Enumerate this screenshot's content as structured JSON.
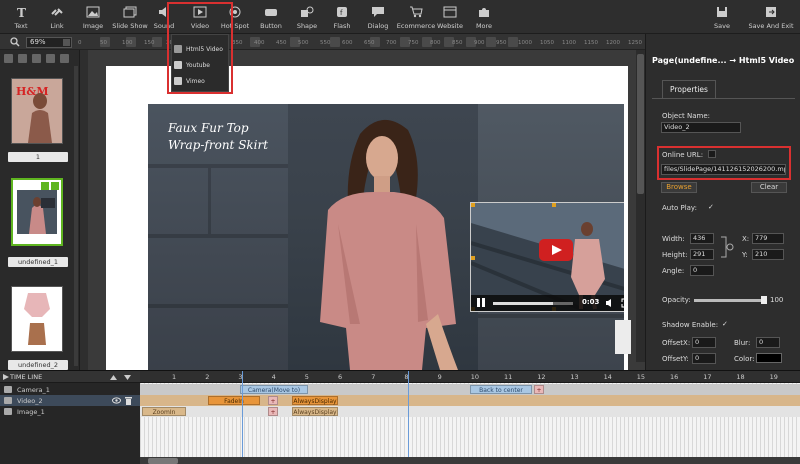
{
  "toolbar": {
    "tools": [
      {
        "label": "Text",
        "icon": "text-icon"
      },
      {
        "label": "Link",
        "icon": "link-icon"
      },
      {
        "label": "Image",
        "icon": "image-icon"
      },
      {
        "label": "Slide Show",
        "icon": "slideshow-icon"
      },
      {
        "label": "Sound",
        "icon": "sound-icon"
      },
      {
        "label": "Video",
        "icon": "video-icon"
      },
      {
        "label": "Hot Spot",
        "icon": "hotspot-icon"
      },
      {
        "label": "Button",
        "icon": "button-icon"
      },
      {
        "label": "Shape",
        "icon": "shape-icon"
      },
      {
        "label": "Flash",
        "icon": "flash-icon"
      },
      {
        "label": "Dialog",
        "icon": "dialog-icon"
      },
      {
        "label": "Ecommerce",
        "icon": "cart-icon"
      },
      {
        "label": "Website",
        "icon": "website-icon"
      },
      {
        "label": "More",
        "icon": "puzzle-icon"
      }
    ],
    "save_label": "Save",
    "save_exit_label": "Save And Exit"
  },
  "video_menu": {
    "items": [
      {
        "label": "Html5 Video",
        "icon": "html5-icon"
      },
      {
        "label": "Youtube",
        "icon": "youtube-icon"
      },
      {
        "label": "Vimeo",
        "icon": "vimeo-icon"
      }
    ]
  },
  "zoom": {
    "value": "69%"
  },
  "ruler_ticks": [
    "0",
    "50",
    "100",
    "150",
    "200",
    "250",
    "300",
    "350",
    "400",
    "450",
    "500",
    "550",
    "600",
    "650",
    "700",
    "750",
    "800",
    "850",
    "900",
    "950",
    "1000",
    "1050",
    "1100",
    "1150",
    "1200",
    "1250"
  ],
  "slides": [
    {
      "label": "1"
    },
    {
      "label": "undefined_1"
    },
    {
      "label": "undefined_2"
    }
  ],
  "canvas": {
    "caption_line1": "Faux Fur Top",
    "caption_line2": "Wrap-front Skirt",
    "video_time": "0:03",
    "video_progress": 0.75
  },
  "properties": {
    "title": "Page(undefine... → Html5 Video",
    "tab": "Properties",
    "object_name_label": "Object Name:",
    "object_name": "Video_2",
    "online_url_label": "Online URL:",
    "file_path": "files/SlidePage/1411261520262​00.mp",
    "browse_label": "Browse",
    "clear_label": "Clear",
    "autoplay_label": "Auto Play:",
    "autoplay_check": "✓",
    "width_label": "Width:",
    "width": "436",
    "height_label": "Height:",
    "height": "291",
    "angle_label": "Angle:",
    "angle": "0",
    "x_label": "X:",
    "x": "779",
    "y_label": "Y:",
    "y": "210",
    "opacity_label": "Opacity:",
    "opacity": "100",
    "shadow_label": "Shadow Enable:",
    "shadow_check": "✓",
    "offsetx_label": "OffsetX:",
    "offsetx": "0",
    "blur_label": "Blur:",
    "blur": "0",
    "offsety_label": "OffsetY:",
    "offsety": "0",
    "color_label": "Color:"
  },
  "timeline": {
    "title": "TIME LINE",
    "rows": [
      {
        "name": "Camera_1",
        "icon": "camera-icon"
      },
      {
        "name": "Video_2",
        "icon": "video-icon"
      },
      {
        "name": "Image_1",
        "icon": "image-icon"
      }
    ],
    "scale": [
      "1",
      "2",
      "3",
      "4",
      "5",
      "6",
      "7",
      "8",
      "9",
      "10",
      "11",
      "12",
      "13",
      "14",
      "15",
      "16",
      "17",
      "18",
      "19"
    ],
    "segments": {
      "camera_move": "Camera(Move to)",
      "camera_back": "Back to center",
      "video_fadein": "FadeIn",
      "video_always": "AlwaysDisplay",
      "image_zoomin": "ZoomIn",
      "image_always": "AlwaysDisplay"
    }
  }
}
